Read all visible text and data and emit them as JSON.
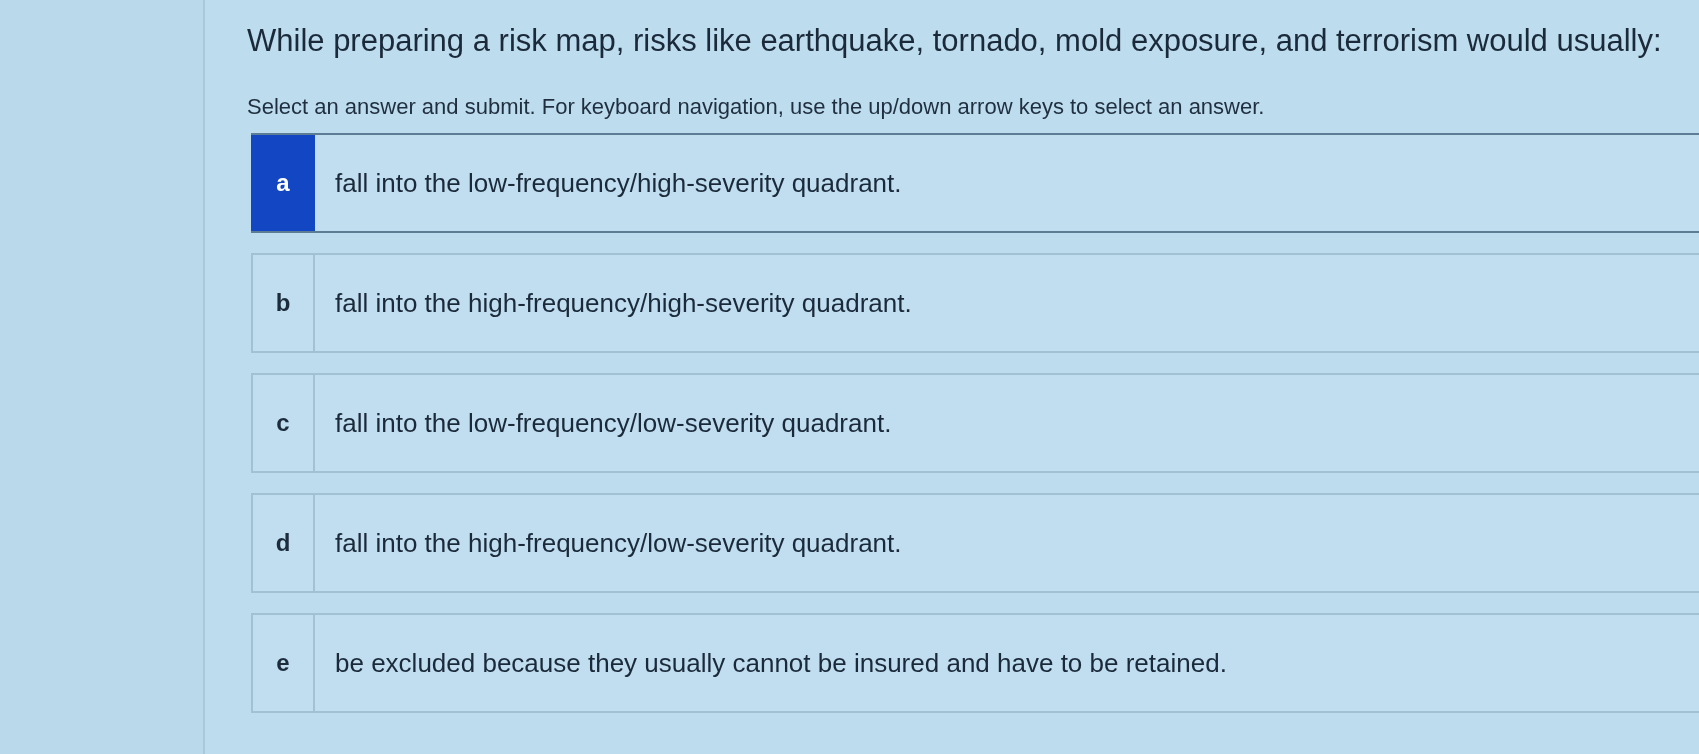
{
  "question": {
    "text": "While preparing a risk map, risks like earthquake, tornado, mold exposure, and terrorism would usually:"
  },
  "instructions": "Select an answer and submit. For keyboard navigation, use the up/down arrow keys to select an answer.",
  "options": [
    {
      "letter": "a",
      "text": "fall into the low-frequency/high-severity quadrant.",
      "selected": true
    },
    {
      "letter": "b",
      "text": "fall into the high-frequency/high-severity quadrant.",
      "selected": false
    },
    {
      "letter": "c",
      "text": "fall into the low-frequency/low-severity quadrant.",
      "selected": false
    },
    {
      "letter": "d",
      "text": "fall into the high-frequency/low-severity quadrant.",
      "selected": false
    },
    {
      "letter": "e",
      "text": "be excluded because they usually cannot be insured and have to be retained.",
      "selected": false
    }
  ]
}
